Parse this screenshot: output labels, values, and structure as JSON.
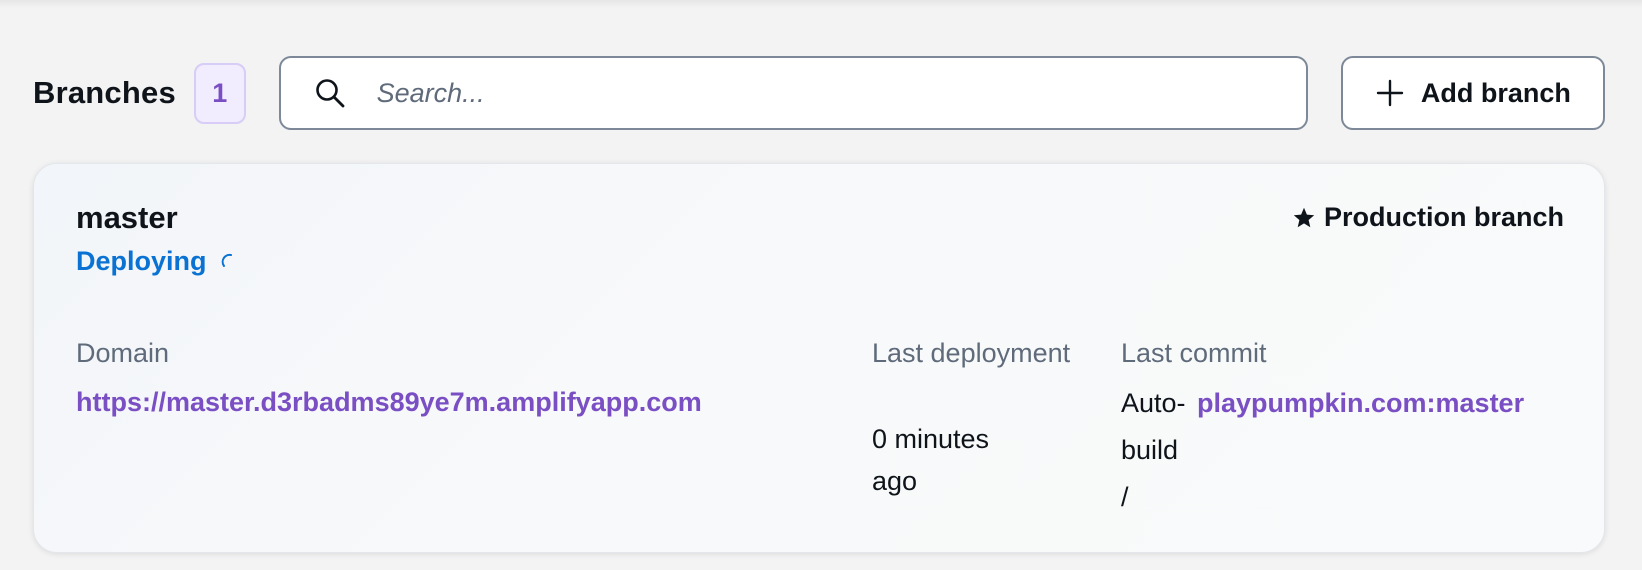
{
  "header": {
    "title": "Branches",
    "count": "1",
    "search_placeholder": "Search...",
    "add_branch_label": "Add branch"
  },
  "branch": {
    "name": "master",
    "status": "Deploying",
    "production_label": "Production branch",
    "domain_label": "Domain",
    "domain_url": "https://master.d3rbadms89ye7m.amplifyapp.com",
    "last_deployment_label": "Last deployment",
    "last_deployment_value": "0 minutes ago",
    "last_commit_label": "Last commit",
    "last_commit_type_line1": "Auto-",
    "last_commit_type_line2": "build",
    "last_commit_type_line3": "/",
    "last_commit_ref": "playpumpkin.com:master"
  },
  "colors": {
    "accent_purple": "#7a4fc4",
    "status_blue": "#0972d3",
    "text_primary": "#0f141a",
    "text_secondary": "#5f6b7a"
  },
  "icons": {
    "search": "search-icon",
    "add": "plus-icon",
    "production": "star-icon",
    "loading": "spinner-icon"
  }
}
